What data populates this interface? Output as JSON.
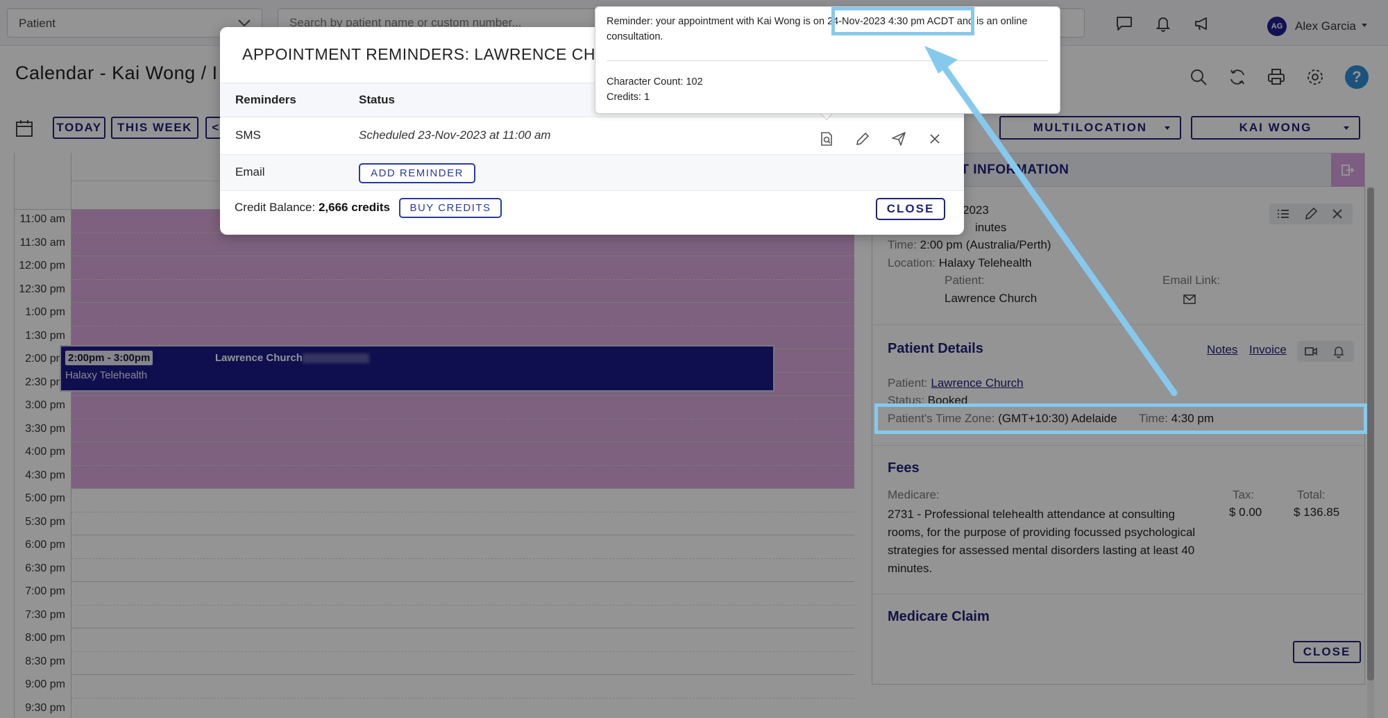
{
  "topbar": {
    "patient_select": "Patient",
    "search_placeholder": "Search by patient name or custom number...",
    "user_initials": "AG",
    "user_name": "Alex Garcia"
  },
  "page": {
    "title": "Calendar - Kai Wong / I"
  },
  "calendar_nav": {
    "today": "TODAY",
    "this_week": "THIS WEEK",
    "multilocation": "MULTILOCATION",
    "practitioner": "KAI WONG"
  },
  "calendar": {
    "times": [
      "11:00 am",
      "11:30 am",
      "12:00 pm",
      "12:30 pm",
      "1:00 pm",
      "1:30 pm",
      "2:00 pm",
      "2:30 pm",
      "3:00 pm",
      "3:30 pm",
      "4:00 pm",
      "4:30 pm",
      "5:00 pm",
      "5:30 pm",
      "6:00 pm",
      "6:30 pm",
      "7:00 pm",
      "7:30 pm",
      "8:00 pm",
      "8:30 pm",
      "9:00 pm",
      "9:30 pm"
    ],
    "appointment": {
      "time": "2:00pm - 3:00pm",
      "patient": "Lawrence Church",
      "location": "Halaxy Telehealth"
    }
  },
  "panel": {
    "header_title": "ENT INFORMATION",
    "date_fragment": "2023",
    "duration_fragment": "inutes",
    "time_label": "Time:",
    "time_value": "2:00 pm (Australia/Perth)",
    "location_label": "Location:",
    "location_value": "Halaxy Telehealth",
    "patient_label": "Patient:",
    "patient_value": "Lawrence Church",
    "email_link_label": "Email Link:",
    "patient_details": {
      "title": "Patient Details",
      "notes_link": "Notes",
      "invoice_link": "Invoice",
      "patient_label": "Patient:",
      "patient_value": "Lawrence Church",
      "status_label": "Status:",
      "status_value": "Booked",
      "timezone_label": "Patient's Time Zone:",
      "timezone_value": "(GMT+10:30) Adelaide",
      "time_label": "Time:",
      "time_value": "4:30 pm"
    },
    "fees": {
      "title": "Fees",
      "medicare_label": "Medicare:",
      "tax_label": "Tax:",
      "total_label": "Total:",
      "item_description": "2731 - Professional telehealth attendance at consulting rooms, for the purpose of providing focussed psychological strategies for assessed mental disorders lasting at least 40 minutes.",
      "tax_value": "$ 0.00",
      "total_value": "$ 136.85"
    },
    "medicare_claim_title": "Medicare Claim",
    "close_label": "CLOSE"
  },
  "modal": {
    "title": "APPOINTMENT REMINDERS: LAWRENCE CHUR",
    "col_reminders": "Reminders",
    "col_status": "Status",
    "rows": [
      {
        "type": "SMS",
        "status": "Scheduled 23-Nov-2023 at 11:00 am"
      },
      {
        "type": "Email",
        "action": "ADD REMINDER"
      }
    ],
    "credit_label": "Credit Balance:",
    "credit_value": "2,666 credits",
    "buy_credits": "BUY CREDITS",
    "close": "CLOSE"
  },
  "tooltip": {
    "message": "Reminder: your appointment with Kai Wong is on 24-Nov-2023 4:30 pm ACDT and is an online consultation.",
    "character_count": "Character Count: 102",
    "credits": "Credits: 1"
  },
  "colors": {
    "brand_navy": "#1f2277",
    "availability_pink": "#d7a8da",
    "appointment_navy": "#1a1a8a",
    "highlight_blue": "#86c9ee"
  }
}
